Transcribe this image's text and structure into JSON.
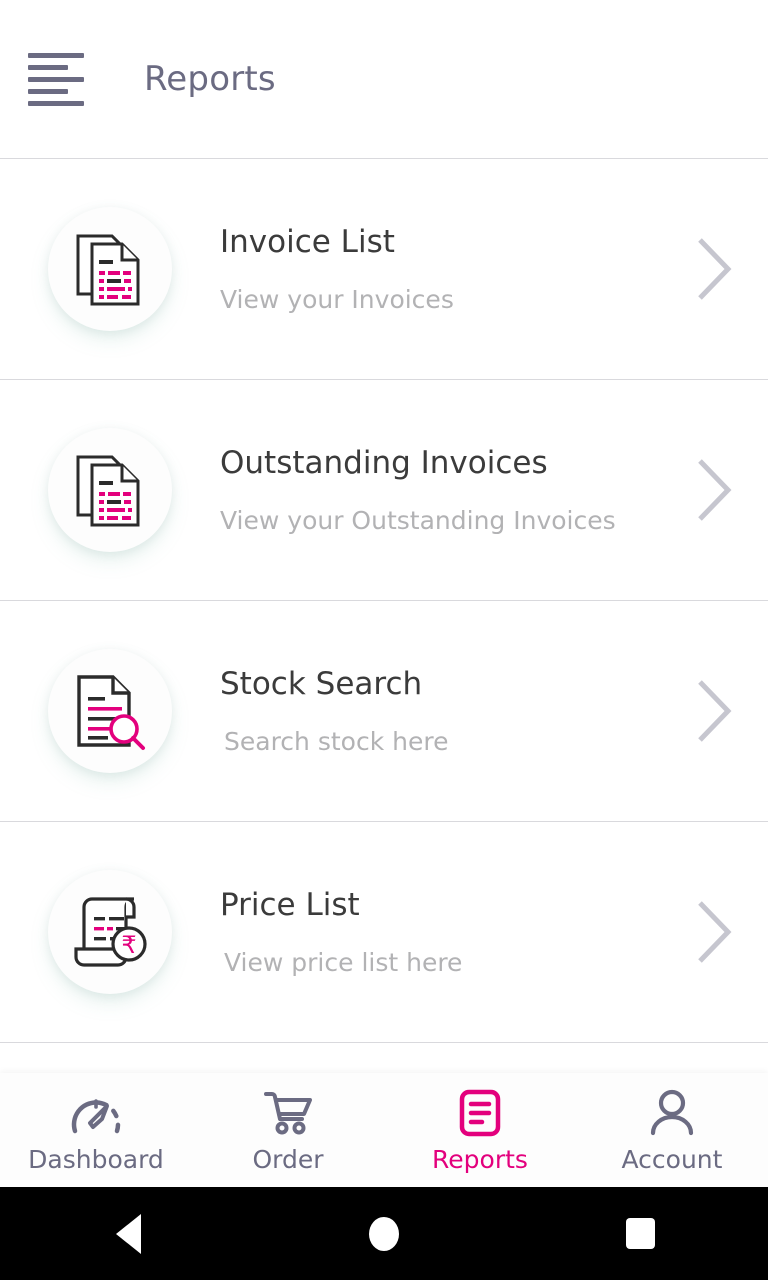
{
  "header": {
    "menu_icon": "hamburger-menu-icon",
    "title": "Reports"
  },
  "colors": {
    "accent_pink": "#e3007d",
    "title_text": "#3b3b3b",
    "subtitle_text": "#b2b2b4",
    "header_text": "#6b6b82",
    "divider": "#d9d9dd",
    "page_background": "#ffffff",
    "icon_outline": "#2b2b2b",
    "chevron": "#c6c6cf"
  },
  "reports": [
    {
      "icon": "stacked-documents-icon",
      "title": "Invoice List",
      "subtitle": "View your Invoices",
      "chevron": "chevron-right-icon"
    },
    {
      "icon": "stacked-documents-icon",
      "title": "Outstanding Invoices",
      "subtitle": "View your Outstanding Invoices",
      "chevron": "chevron-right-icon"
    },
    {
      "icon": "document-search-icon",
      "title": "Stock Search",
      "subtitle": "Search stock here",
      "chevron": "chevron-right-icon"
    },
    {
      "icon": "price-scroll-rupee-icon",
      "title": "Price List",
      "subtitle": "View price list here",
      "chevron": "chevron-right-icon"
    }
  ],
  "tabbar": {
    "items": [
      {
        "icon": "speedometer-icon",
        "label": "Dashboard",
        "active": false
      },
      {
        "icon": "shopping-cart-icon",
        "label": "Order",
        "active": false
      },
      {
        "icon": "document-lines-icon",
        "label": "Reports",
        "active": true
      },
      {
        "icon": "person-icon",
        "label": "Account",
        "active": false
      }
    ]
  },
  "system_nav": {
    "back": "back-triangle-icon",
    "home": "home-circle-icon",
    "recents": "recents-square-icon"
  }
}
